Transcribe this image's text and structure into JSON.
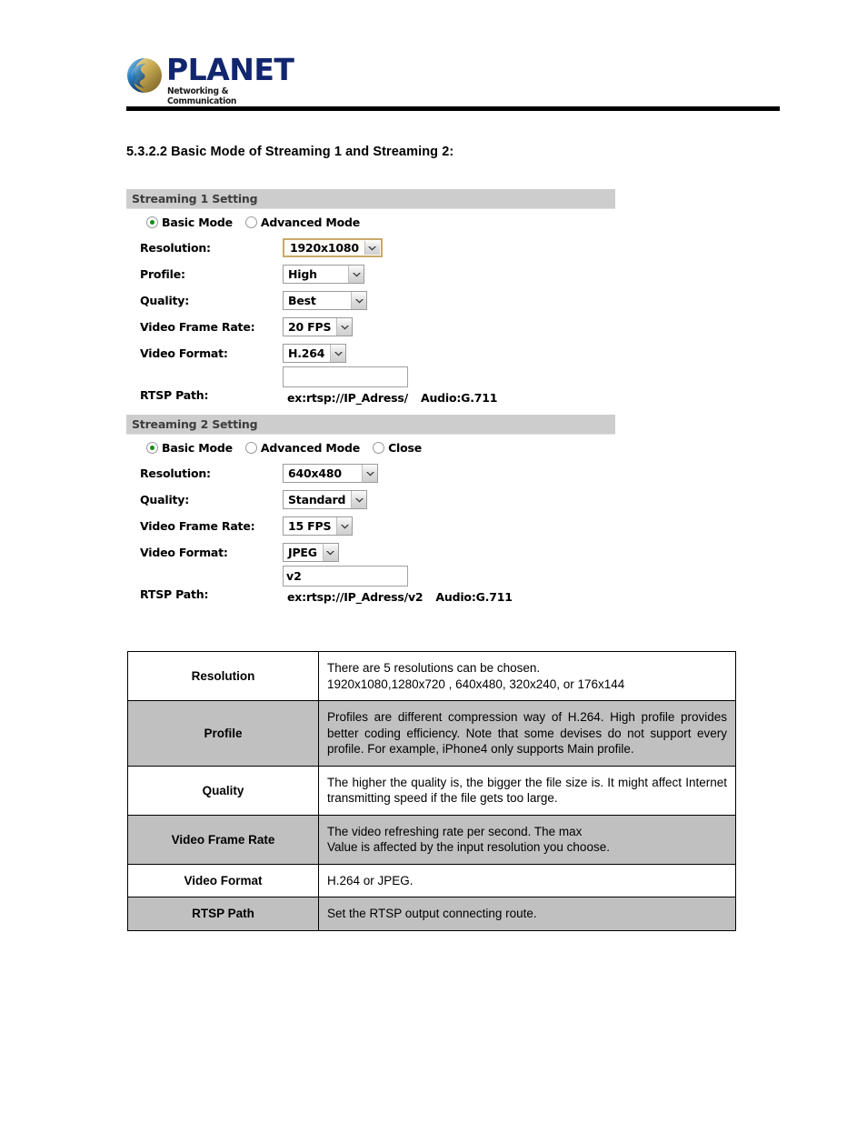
{
  "header": {
    "logo_wordmark": "PLANET",
    "logo_tagline": "Networking & Communication"
  },
  "section": {
    "heading": "5.3.2.2 Basic Mode of Streaming 1 and Streaming 2:"
  },
  "streaming1": {
    "panel_title": "Streaming 1 Setting",
    "modes": [
      {
        "label": "Basic Mode",
        "checked": true
      },
      {
        "label": "Advanced Mode",
        "checked": false
      }
    ],
    "fields": {
      "resolution_label": "Resolution:",
      "resolution_value": "1920x1080",
      "profile_label": "Profile:",
      "profile_value": "High",
      "quality_label": "Quality:",
      "quality_value": "Best",
      "framerate_label": "Video Frame Rate:",
      "framerate_value": "20 FPS",
      "format_label": "Video Format:",
      "format_value": "H.264",
      "rtsp_label": "RTSP Path:",
      "rtsp_value": "",
      "rtsp_hint_example": "ex:rtsp://IP_Adress/",
      "rtsp_hint_audio": "Audio:G.711"
    }
  },
  "streaming2": {
    "panel_title": "Streaming 2 Setting",
    "modes": [
      {
        "label": "Basic Mode",
        "checked": true
      },
      {
        "label": "Advanced Mode",
        "checked": false
      },
      {
        "label": "Close",
        "checked": false
      }
    ],
    "fields": {
      "resolution_label": "Resolution:",
      "resolution_value": "640x480",
      "quality_label": "Quality:",
      "quality_value": "Standard",
      "framerate_label": "Video Frame Rate:",
      "framerate_value": "15 FPS",
      "format_label": "Video Format:",
      "format_value": "JPEG",
      "rtsp_label": "RTSP Path:",
      "rtsp_value": "v2",
      "rtsp_hint_example": "ex:rtsp://IP_Adress/v2",
      "rtsp_hint_audio": "Audio:G.711"
    }
  },
  "description_table": {
    "rows": [
      {
        "term": "Resolution",
        "lines": [
          "There are 5 resolutions can be chosen.",
          "1920x1080,1280x720 , 640x480, 320x240, or 176x144"
        ],
        "shaded": false
      },
      {
        "term": "Profile",
        "lines": [
          "Profiles are different compression way of H.264. High profile provides better coding efficiency. Note that some devises do not support every profile. For example, iPhone4 only supports Main profile."
        ],
        "shaded": true
      },
      {
        "term": "Quality",
        "lines": [
          "The higher the quality is, the bigger the file size is. It might affect Internet transmitting speed if the file gets too large."
        ],
        "shaded": false
      },
      {
        "term": "Video Frame Rate",
        "lines": [
          "The video refreshing rate per second. The max",
          "Value is affected by the input resolution you choose."
        ],
        "shaded": true
      },
      {
        "term": "Video Format",
        "lines": [
          "H.264 or JPEG."
        ],
        "shaded": false
      },
      {
        "term": "RTSP Path",
        "lines": [
          "Set the RTSP output connecting route."
        ],
        "shaded": true
      }
    ]
  },
  "colors": {
    "panel_header_bg": "#cdcdcd",
    "brand_blue": "#11266e",
    "radio_dot_green": "#168c16",
    "focus_border": "#c9a96a",
    "table_shaded_bg": "#c0c0c0"
  }
}
